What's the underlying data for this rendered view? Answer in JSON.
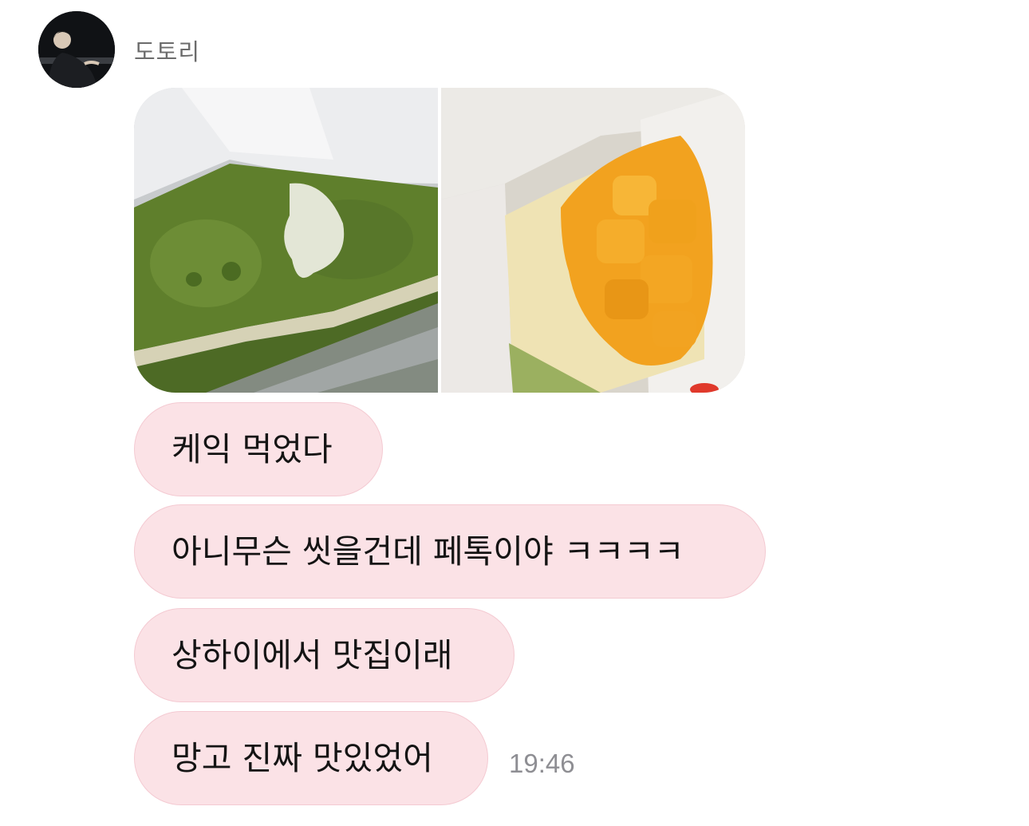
{
  "conversation": {
    "sender_name": "도토리",
    "avatar_icon": "profile-photo",
    "photos": [
      {
        "name": "matcha-cake-photo",
        "icon": "photo-image",
        "colors": [
          "#5e7d2e",
          "#e6e8e9"
        ]
      },
      {
        "name": "mango-cake-photo",
        "icon": "photo-image",
        "colors": [
          "#f0a21c",
          "#efe7d2"
        ]
      }
    ],
    "messages": [
      {
        "text": "케익 먹었다"
      },
      {
        "text": "아니무슨 씻을건데 페톡이야 ㅋㅋㅋㅋ"
      },
      {
        "text": "상하이에서 맛집이래"
      },
      {
        "text": "망고 진짜 맛있었어"
      }
    ],
    "last_timestamp": "19:46"
  },
  "colors": {
    "bubble_background": "#fbe2e6",
    "bubble_border": "#f4cad2",
    "sender_text": "#6b6b6b",
    "timestamp_text": "#8e8e93"
  }
}
